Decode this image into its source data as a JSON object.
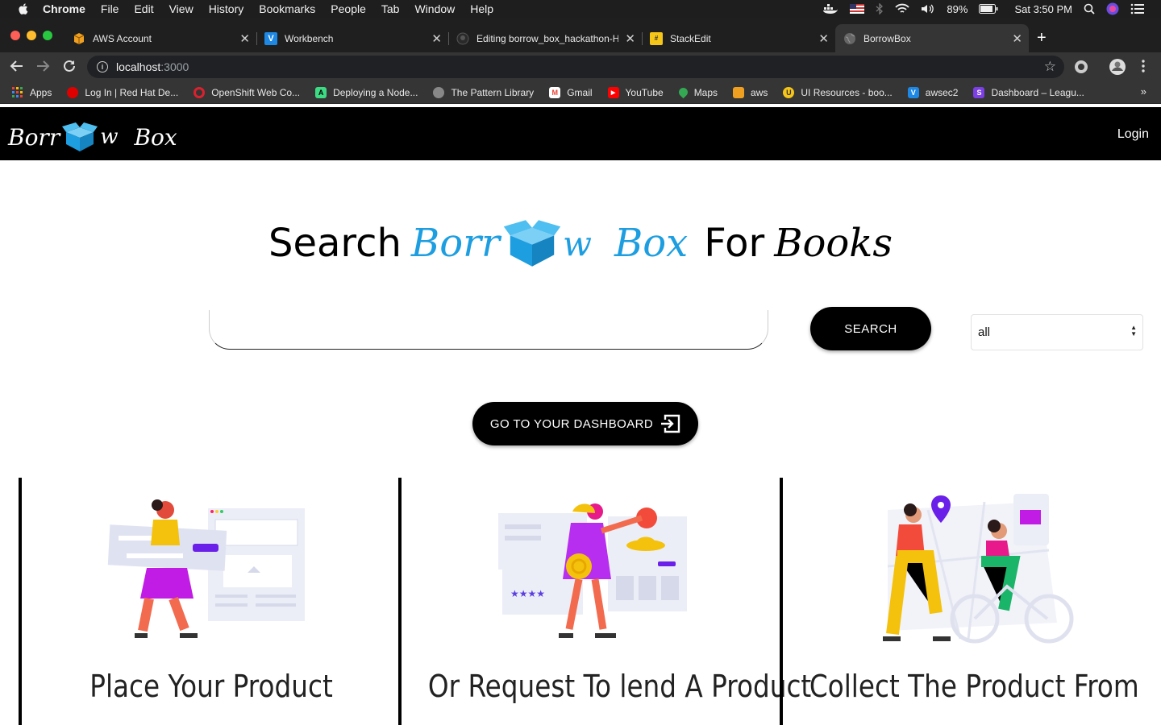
{
  "menubar": {
    "items": [
      "Chrome",
      "File",
      "Edit",
      "View",
      "History",
      "Bookmarks",
      "People",
      "Tab",
      "Window",
      "Help"
    ],
    "battery": "89%",
    "clock": "Sat 3:50 PM"
  },
  "tabs": [
    {
      "title": "AWS Account",
      "icon": "aws-box-icon",
      "color": "#f0a020"
    },
    {
      "title": "Workbench",
      "icon": "v-logo-icon",
      "color": "#1e88e5"
    },
    {
      "title": "Editing borrow_box_hackathon-H",
      "icon": "github-icon",
      "color": "#555555"
    },
    {
      "title": "StackEdit",
      "icon": "stackedit-icon",
      "color": "#f5c518"
    },
    {
      "title": "BorrowBox",
      "icon": "globe-icon",
      "color": "#777777"
    }
  ],
  "address": {
    "host": "localhost",
    "port": ":3000"
  },
  "bookmarks": [
    {
      "label": "Apps",
      "icon": "apps-grid-icon",
      "color": "#4285f4"
    },
    {
      "label": "Log In | Red Hat De...",
      "icon": "redhat-icon",
      "color": "#e00000"
    },
    {
      "label": "OpenShift Web Co...",
      "icon": "openshift-icon",
      "color": "#db212e"
    },
    {
      "label": "Deploying a Node...",
      "icon": "android-icon",
      "color": "#3ddc84"
    },
    {
      "label": "The Pattern Library",
      "icon": "globe-icon",
      "color": "#888888"
    },
    {
      "label": "Gmail",
      "icon": "gmail-icon",
      "color": "#ea4335"
    },
    {
      "label": "YouTube",
      "icon": "youtube-icon",
      "color": "#ff0000"
    },
    {
      "label": "Maps",
      "icon": "maps-pin-icon",
      "color": "#34a853"
    },
    {
      "label": "aws",
      "icon": "aws-box-icon",
      "color": "#f0a020"
    },
    {
      "label": "UI Resources - boo...",
      "icon": "ui-resources-icon",
      "color": "#f5c518"
    },
    {
      "label": "awsec2",
      "icon": "v-logo-icon",
      "color": "#1e88e5"
    },
    {
      "label": "Dashboard – Leagu...",
      "icon": "s-logo-icon",
      "color": "#7b3fe4"
    }
  ],
  "app": {
    "logo_left": "Borr",
    "logo_mid": "w",
    "logo_right": "Box",
    "login": "Login",
    "hero_prefix": "Search",
    "hero_suffix": "For",
    "hero_last": "Books",
    "search_button": "SEARCH",
    "search_value": "",
    "category": "all",
    "dashboard_button": "GO TO YOUR DASHBOARD",
    "brand_color": "#1d9ee0",
    "cards": [
      {
        "title": "Place Your Product"
      },
      {
        "title": "Or Request To lend A Product"
      },
      {
        "title": "Collect The Product From"
      }
    ]
  }
}
